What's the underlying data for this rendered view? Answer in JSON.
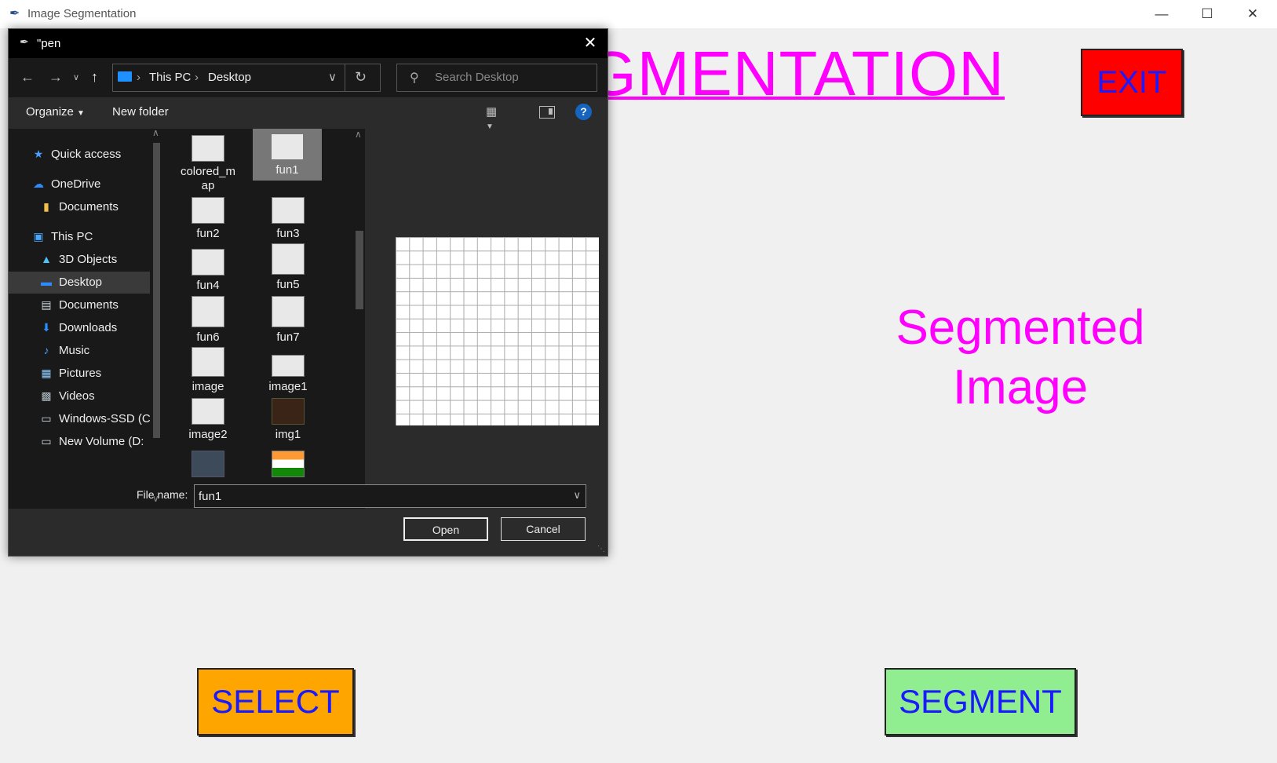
{
  "app": {
    "title": "Image Segmentation",
    "heading": "GMENTATION",
    "exit_label": "EXIT",
    "segmented_line1": "Segmented",
    "segmented_line2": "Image",
    "select_label": "SELECT",
    "segment_label": "SEGMENT",
    "colors": {
      "heading": "#ff00ff",
      "exit_bg": "#ff0000",
      "select_bg": "#ffa500",
      "segment_bg": "#90ee90",
      "button_text": "#1a1aff"
    }
  },
  "dialog": {
    "title": "\"pen",
    "breadcrumb": [
      "This PC",
      "Desktop"
    ],
    "search_placeholder": "Search Desktop",
    "toolbar": {
      "organize": "Organize",
      "new_folder": "New folder"
    },
    "nav_items": [
      {
        "label": "Quick access",
        "icon": "star-icon"
      },
      {
        "label": "OneDrive",
        "icon": "cloud-icon"
      },
      {
        "label": "Documents",
        "icon": "folder-icon"
      },
      {
        "label": "This PC",
        "icon": "computer-icon"
      },
      {
        "label": "3D Objects",
        "icon": "cube-icon"
      },
      {
        "label": "Desktop",
        "icon": "desktop-icon"
      },
      {
        "label": "Documents",
        "icon": "document-icon"
      },
      {
        "label": "Downloads",
        "icon": "download-icon"
      },
      {
        "label": "Music",
        "icon": "music-icon"
      },
      {
        "label": "Pictures",
        "icon": "picture-icon"
      },
      {
        "label": "Videos",
        "icon": "video-icon"
      },
      {
        "label": "Windows-SSD (C",
        "icon": "drive-icon"
      },
      {
        "label": "New Volume (D:",
        "icon": "drive-icon"
      }
    ],
    "files": [
      {
        "name": "colored_m",
        "name2": "ap"
      },
      {
        "name": "fun1"
      },
      {
        "name": "fun2"
      },
      {
        "name": "fun3"
      },
      {
        "name": "fun4"
      },
      {
        "name": "fun5"
      },
      {
        "name": "fun6"
      },
      {
        "name": "fun7"
      },
      {
        "name": "image"
      },
      {
        "name": "image1"
      },
      {
        "name": "image2"
      },
      {
        "name": "img1"
      }
    ],
    "selected_file": "fun1",
    "file_name_label": "File name:",
    "file_name_value": "fun1",
    "open_label": "Open",
    "cancel_label": "Cancel"
  }
}
